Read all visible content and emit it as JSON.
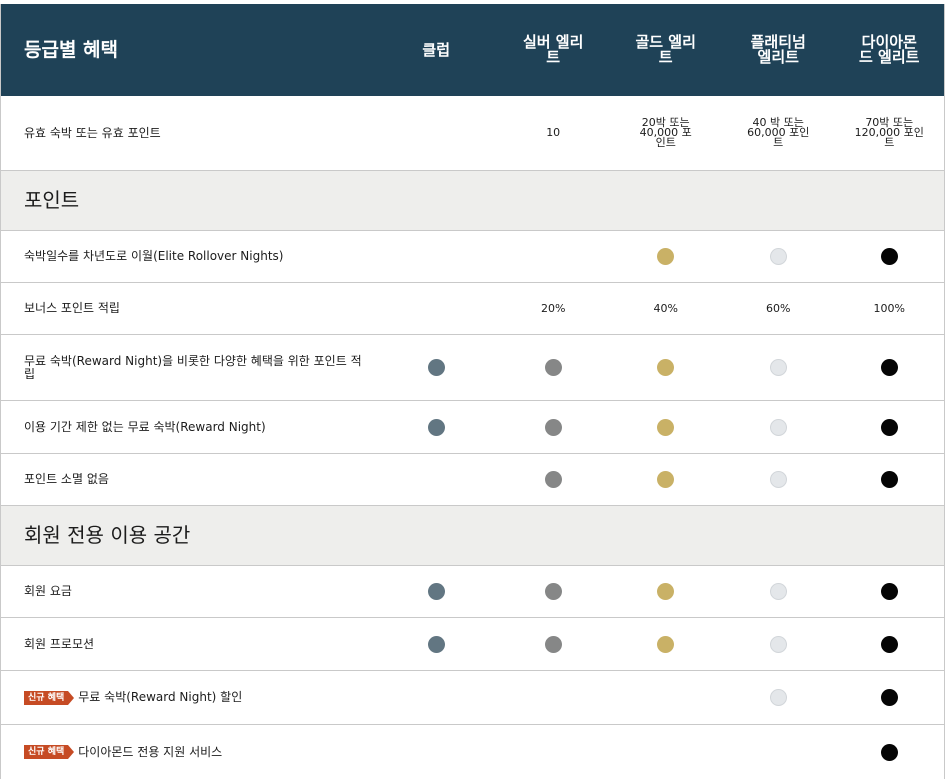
{
  "header": {
    "title": "등급별 혜택",
    "tiers": [
      "클럽",
      "실버 엘리트",
      "골드 엘리트",
      "플래티넘 엘리트",
      "다이아몬드 엘리트"
    ]
  },
  "colors": {
    "header_bg": "#1f4257",
    "club": "#627682",
    "silver": "#868787",
    "gold": "#c9b166",
    "platinum": "#e4e7ea",
    "diamond": "#050505",
    "badge": "#c64b24"
  },
  "badge_label": "신규 혜택",
  "rows": [
    {
      "type": "benefit",
      "label": "유효 숙박 또는 유효 포인트",
      "cells": [
        "",
        "10",
        "20박 또는 40,000 포인트",
        "40 박 또는 60,000 포인트",
        "70박 또는 120,000 포인트"
      ]
    },
    {
      "type": "section",
      "label": "포인트"
    },
    {
      "type": "benefit",
      "label": "숙박일수를 차년도로 이월(Elite Rollover Nights)",
      "dots": [
        "",
        "",
        "gold",
        "platinum",
        "diamond"
      ]
    },
    {
      "type": "benefit",
      "label": "보너스 포인트 적립",
      "cells": [
        "",
        "20%",
        "40%",
        "60%",
        "100%"
      ]
    },
    {
      "type": "benefit",
      "label": "무료 숙박(Reward Night)을 비롯한 다양한 혜택을 위한 포인트 적립",
      "dots": [
        "club",
        "silver",
        "gold",
        "platinum",
        "diamond"
      ]
    },
    {
      "type": "benefit",
      "label": "이용 기간 제한 없는 무료 숙박(Reward Night)",
      "dots": [
        "club",
        "silver",
        "gold",
        "platinum",
        "diamond"
      ]
    },
    {
      "type": "benefit",
      "label": "포인트 소멸 없음",
      "dots": [
        "",
        "silver",
        "gold",
        "platinum",
        "diamond"
      ]
    },
    {
      "type": "section",
      "label": "회원 전용 이용 공간"
    },
    {
      "type": "benefit",
      "label": "회원 요금",
      "dots": [
        "club",
        "silver",
        "gold",
        "platinum",
        "diamond"
      ]
    },
    {
      "type": "benefit",
      "label": "회원 프로모션",
      "dots": [
        "club",
        "silver",
        "gold",
        "platinum",
        "diamond"
      ]
    },
    {
      "type": "benefit",
      "badge": true,
      "label": "무료 숙박(Reward Night) 할인",
      "dots": [
        "",
        "",
        "",
        "platinum",
        "diamond"
      ]
    },
    {
      "type": "benefit",
      "badge": true,
      "label": "다이아몬드 전용 지원 서비스",
      "dots": [
        "",
        "",
        "",
        "",
        "diamond"
      ]
    }
  ]
}
